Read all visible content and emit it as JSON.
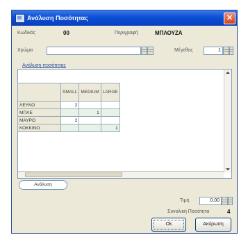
{
  "window": {
    "title": "Ανάλυση Ποσότητας",
    "close_glyph": "✕"
  },
  "header": {
    "code_label": "Κωδικός",
    "code_value": "00",
    "description_label": "Περιγραφή",
    "description_value": "ΜΠΛΟΥΖΑ",
    "color_label": "Χρώμα",
    "color_value": "",
    "size_label": "Μέγεθος",
    "size_value": "1"
  },
  "grid": {
    "group_title": "Ανάλυση ποσότητας",
    "columns": [
      "SMALL",
      "MEDIUM",
      "LARGE"
    ],
    "rows": [
      {
        "label": "ΛΕΥΚΟ",
        "values": [
          "2",
          "",
          ""
        ]
      },
      {
        "label": "ΜΠΛΕ",
        "values": [
          "",
          "1",
          ""
        ]
      },
      {
        "label": "ΜΑΥΡΟ",
        "values": [
          "2",
          "",
          ""
        ]
      },
      {
        "label": "ΚΟΚΚΙΝΟ",
        "values": [
          "",
          "",
          "1"
        ]
      }
    ]
  },
  "tabs": {
    "active_label": "Ανάλυση"
  },
  "footer": {
    "total_label": "Τιμή",
    "total_value": "0.00",
    "sum_label": "Συνολική Ποσότητα",
    "sum_value": "4",
    "ok_label": "Ok",
    "cancel_label": "Ακύρωση"
  }
}
